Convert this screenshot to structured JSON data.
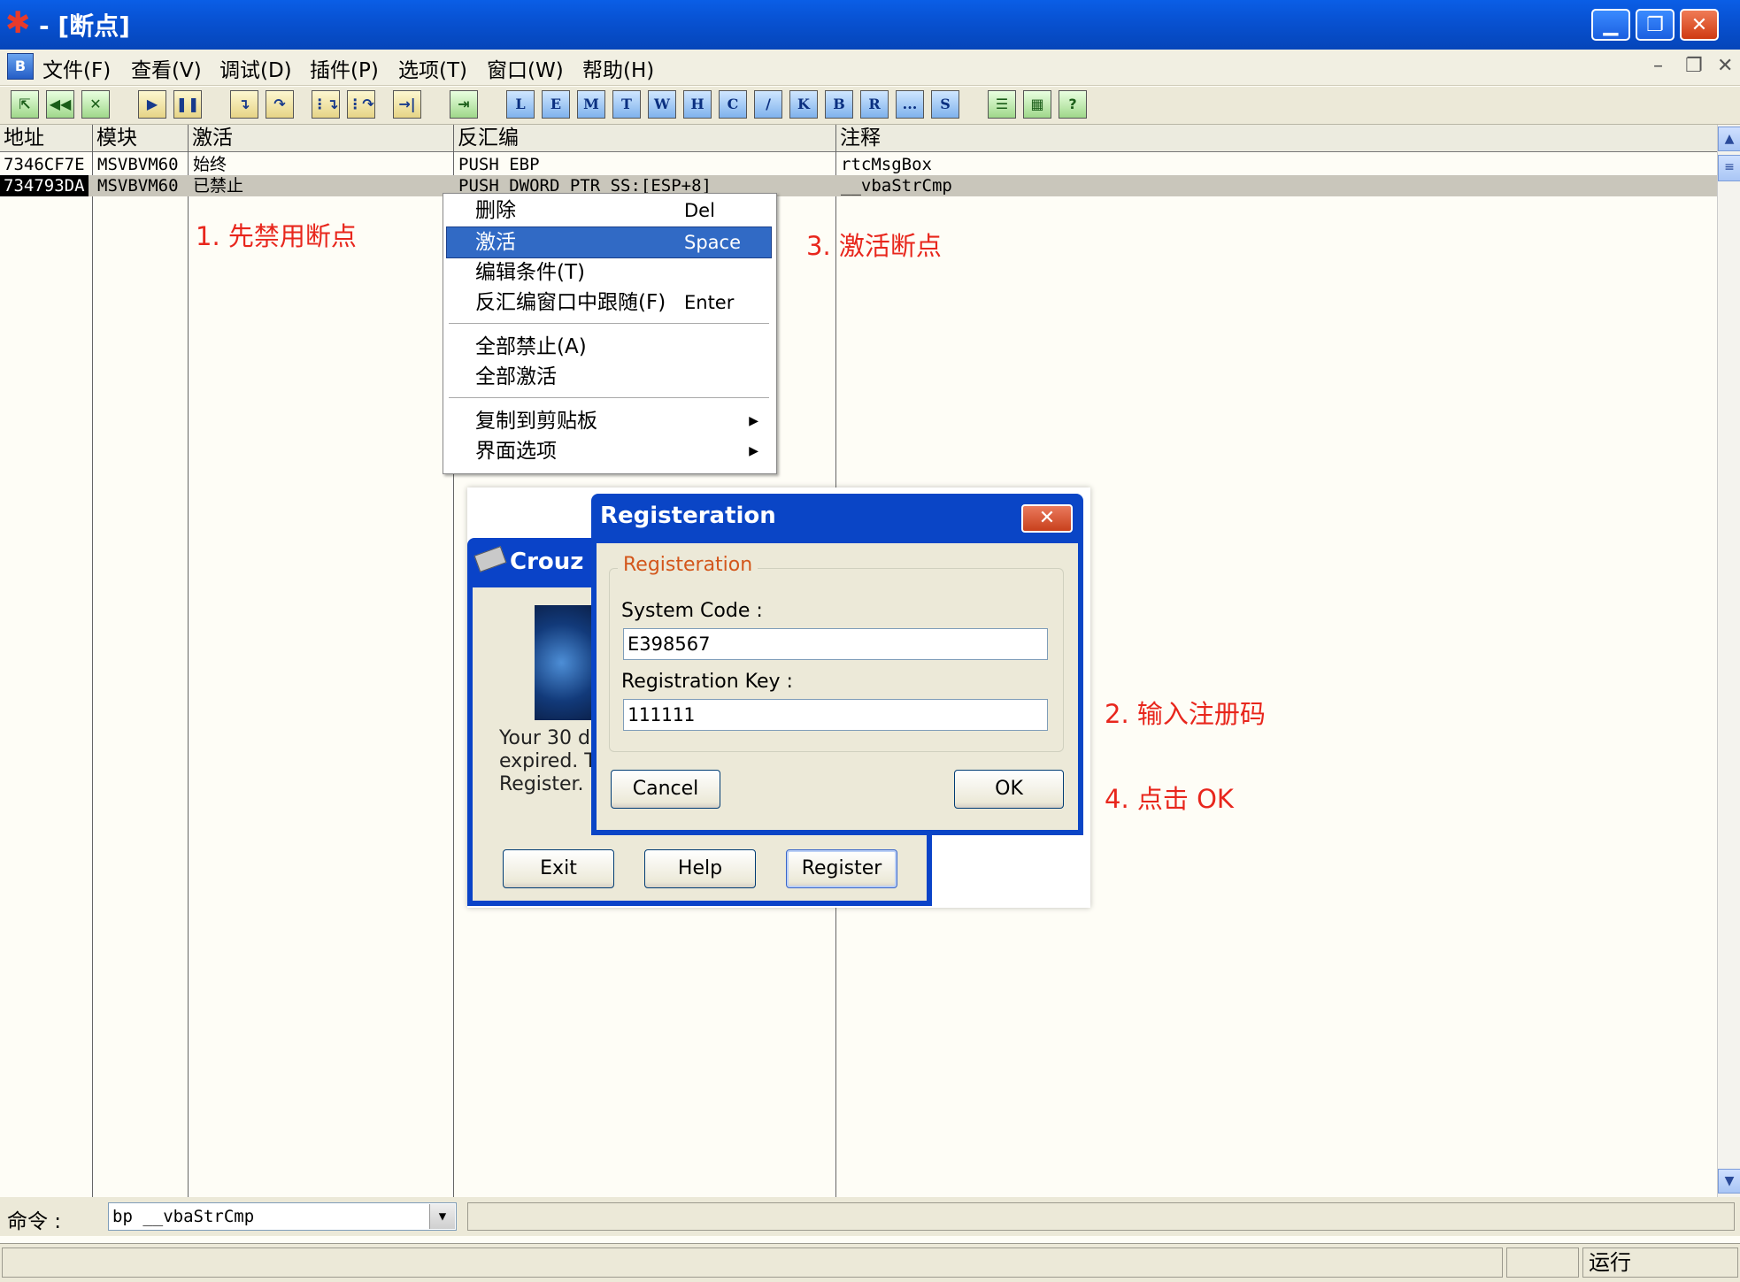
{
  "window": {
    "title": "- [断点]",
    "min": "▁",
    "max": "❐",
    "close": "✕"
  },
  "menubar": {
    "badge": "B",
    "items": [
      "文件(F)",
      "查看(V)",
      "调试(D)",
      "插件(P)",
      "选项(T)",
      "窗口(W)",
      "帮助(H)"
    ],
    "mdi_min": "–",
    "mdi_restore": "❐",
    "mdi_close": "✕"
  },
  "toolbar": {
    "letters": [
      "L",
      "E",
      "M",
      "T",
      "W",
      "H",
      "C",
      "/",
      "K",
      "B",
      "R",
      "...",
      "S"
    ],
    "help": "?"
  },
  "columns": [
    "地址",
    "模块",
    "激活",
    "反汇编",
    "注释"
  ],
  "rows": [
    {
      "addr": "7346CF7E",
      "module": "MSVBVM60",
      "active": "始终",
      "disasm": "PUSH EBP",
      "comment": "rtcMsgBox"
    },
    {
      "addr": "734793DA",
      "module": "MSVBVM60",
      "active": "已禁止",
      "disasm": "PUSH DWORD PTR SS:[ESP+8]",
      "comment": "__vbaStrCmp"
    }
  ],
  "annotations": {
    "step1": "1. 先禁用断点",
    "step2": "2. 输入注册码",
    "step3": "3. 激活断点",
    "step4": "4. 点击 OK"
  },
  "context_menu": {
    "items": [
      {
        "label": "删除",
        "key": "Del"
      },
      {
        "label": "激活",
        "key": "Space"
      },
      {
        "label": "编辑条件(T)",
        "key": ""
      },
      {
        "label": "反汇编窗口中跟随(F)",
        "key": "Enter"
      },
      {
        "label": "全部禁止(A)",
        "key": ""
      },
      {
        "label": "全部激活",
        "key": ""
      },
      {
        "label": "复制到剪贴板",
        "key": ""
      },
      {
        "label": "界面选项",
        "key": ""
      }
    ]
  },
  "crouz": {
    "title": "Crouz C",
    "message": "Your 30 da\nexpired. T\nRegister.",
    "exit": "Exit",
    "help": "Help",
    "register": "Register"
  },
  "reg_dialog": {
    "title": "Registeration",
    "close": "✕",
    "group": "Registeration",
    "system_code_label": "System Code :",
    "system_code": "E398567",
    "key_label": "Registration Key :",
    "key": "111111",
    "cancel": "Cancel",
    "ok": "OK"
  },
  "command": {
    "label": "命令 :",
    "value": "bp __vbaStrCmp"
  },
  "status": {
    "state": "运行"
  },
  "colors": {
    "accent": "#316ac5",
    "annotation": "#e8261c",
    "titlebar": "#0852d3"
  }
}
